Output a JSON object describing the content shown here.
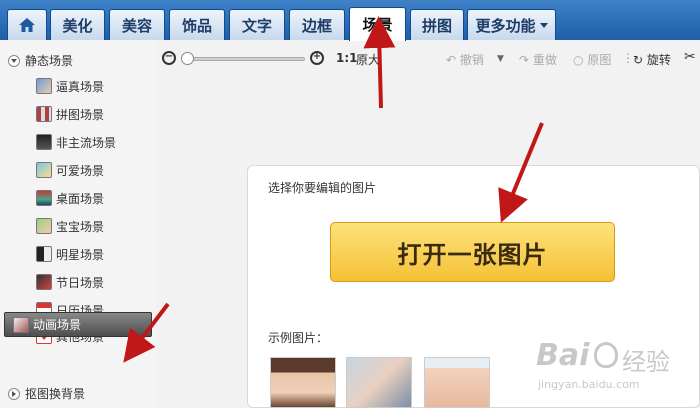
{
  "tabs": [
    {
      "key": "home",
      "label": ""
    },
    {
      "key": "beautify",
      "label": "美化"
    },
    {
      "key": "cosmetic",
      "label": "美容"
    },
    {
      "key": "accessory",
      "label": "饰品"
    },
    {
      "key": "text",
      "label": "文字"
    },
    {
      "key": "border",
      "label": "边框"
    },
    {
      "key": "scene",
      "label": "场景",
      "active": true
    },
    {
      "key": "collage",
      "label": "拼图"
    },
    {
      "key": "more",
      "label": "更多功能"
    }
  ],
  "sidebar": {
    "static_section": "静态场景",
    "items": [
      "逼真场景",
      "拼图场景",
      "非主流场景",
      "可爱场景",
      "桌面场景",
      "宝宝场景",
      "明星场景",
      "节日场景",
      "日历场景",
      "其他场景"
    ],
    "animated": "动画场景",
    "cutout_section": "抠图换背景"
  },
  "toolbar": {
    "zoom_ratio": "1:1",
    "original_size": "原大",
    "undo": "撤销",
    "redo": "重做",
    "original": "原图",
    "rotate": "旋转"
  },
  "panel": {
    "prompt": "选择你要编辑的图片",
    "open_button": "打开一张图片",
    "examples_label": "示例图片："
  },
  "watermark": {
    "brand": "Bai",
    "brand2": "经验",
    "url": "jingyan.baidu.com"
  },
  "colors": {
    "tab_bar": "#1e5fa8",
    "open_button": "#f5c136",
    "arrow": "#c01818"
  }
}
